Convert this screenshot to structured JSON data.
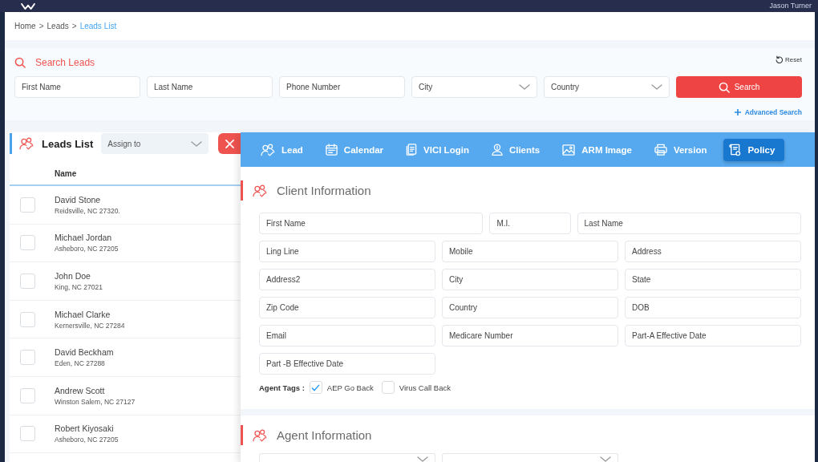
{
  "header": {
    "user_name": "Jason Turner"
  },
  "breadcrumb": {
    "items": [
      {
        "label": "Home",
        "selected": false,
        "separator": ">"
      },
      {
        "label": "Leads",
        "selected": false,
        "separator": ">"
      },
      {
        "label": "Leads List",
        "selected": true
      }
    ]
  },
  "search_panel": {
    "title": "Search Leads",
    "reset": "Reset",
    "fields": [
      {
        "kind": "text",
        "placeholder": "First Name"
      },
      {
        "kind": "text",
        "placeholder": "Last Name"
      },
      {
        "kind": "text",
        "placeholder": "Phone Number"
      },
      {
        "kind": "select",
        "placeholder": "City"
      },
      {
        "kind": "select",
        "placeholder": "Country"
      }
    ],
    "search_button": "Search",
    "advanced_search": "Advanced Search"
  },
  "leads_list": {
    "title": "Leads List",
    "assign_to": {
      "placeholder": "Assign to"
    },
    "columns": [
      "Name"
    ],
    "rows": [
      {
        "checked": false,
        "name": "David Stone",
        "address": "Reidsville, NC 27320."
      },
      {
        "checked": false,
        "name": "Michael Jordan",
        "address": "Asheboro, NC 27205"
      },
      {
        "checked": false,
        "name": "John Doe",
        "address": "King, NC 27021"
      },
      {
        "checked": false,
        "name": "Michael Clarke",
        "address": "Kernersville, NC 27284"
      },
      {
        "checked": false,
        "name": "David Beckham",
        "address": "Eden, NC 27288"
      },
      {
        "checked": false,
        "name": "Andrew Scott",
        "address": "Winston Salem, NC 27127"
      },
      {
        "checked": false,
        "name": "Robert Kiyosaki",
        "address": "Asheboro, NC 27205"
      }
    ]
  },
  "detail_panel": {
    "tabs": [
      {
        "label": "Lead",
        "selected": false
      },
      {
        "label": "Calendar",
        "selected": false
      },
      {
        "label": "VICI Login",
        "selected": false
      },
      {
        "label": "Clients",
        "selected": false
      },
      {
        "label": "ARM Image",
        "selected": false
      },
      {
        "label": "Version",
        "selected": false
      },
      {
        "label": "Policy",
        "selected": true
      }
    ],
    "client_information": {
      "title": "Client Information",
      "rows": [
        {
          "kind": "name",
          "fields": [
            {
              "placeholder": "First Name"
            },
            {
              "placeholder": "M.I."
            },
            {
              "placeholder": "Last Name"
            }
          ]
        },
        {
          "kind": "standard",
          "fields": [
            {
              "placeholder": "Ling Line"
            },
            {
              "placeholder": "Mobile"
            },
            {
              "placeholder": "Address"
            }
          ]
        },
        {
          "kind": "standard",
          "fields": [
            {
              "placeholder": "Address2"
            },
            {
              "placeholder": "City"
            },
            {
              "placeholder": "State"
            }
          ]
        },
        {
          "kind": "standard",
          "fields": [
            {
              "placeholder": "Zip Code"
            },
            {
              "placeholder": "Country"
            },
            {
              "placeholder": "DOB"
            }
          ]
        },
        {
          "kind": "standard",
          "fields": [
            {
              "placeholder": "Email"
            },
            {
              "placeholder": "Medicare Number"
            },
            {
              "placeholder": "Part-A Effective Date"
            }
          ]
        },
        {
          "kind": "standard",
          "fields": [
            {
              "placeholder": "Part -B Effective Date"
            }
          ]
        }
      ],
      "agent_tags": {
        "label": "Agent Tags :",
        "options": [
          {
            "label": "AEP Go Back",
            "checked": true
          },
          {
            "label": "Virus Call Back",
            "checked": false
          }
        ]
      }
    },
    "agent_information": {
      "title": "Agent Information",
      "fields": [
        {
          "kind": "select"
        },
        {
          "kind": "select"
        }
      ]
    }
  }
}
